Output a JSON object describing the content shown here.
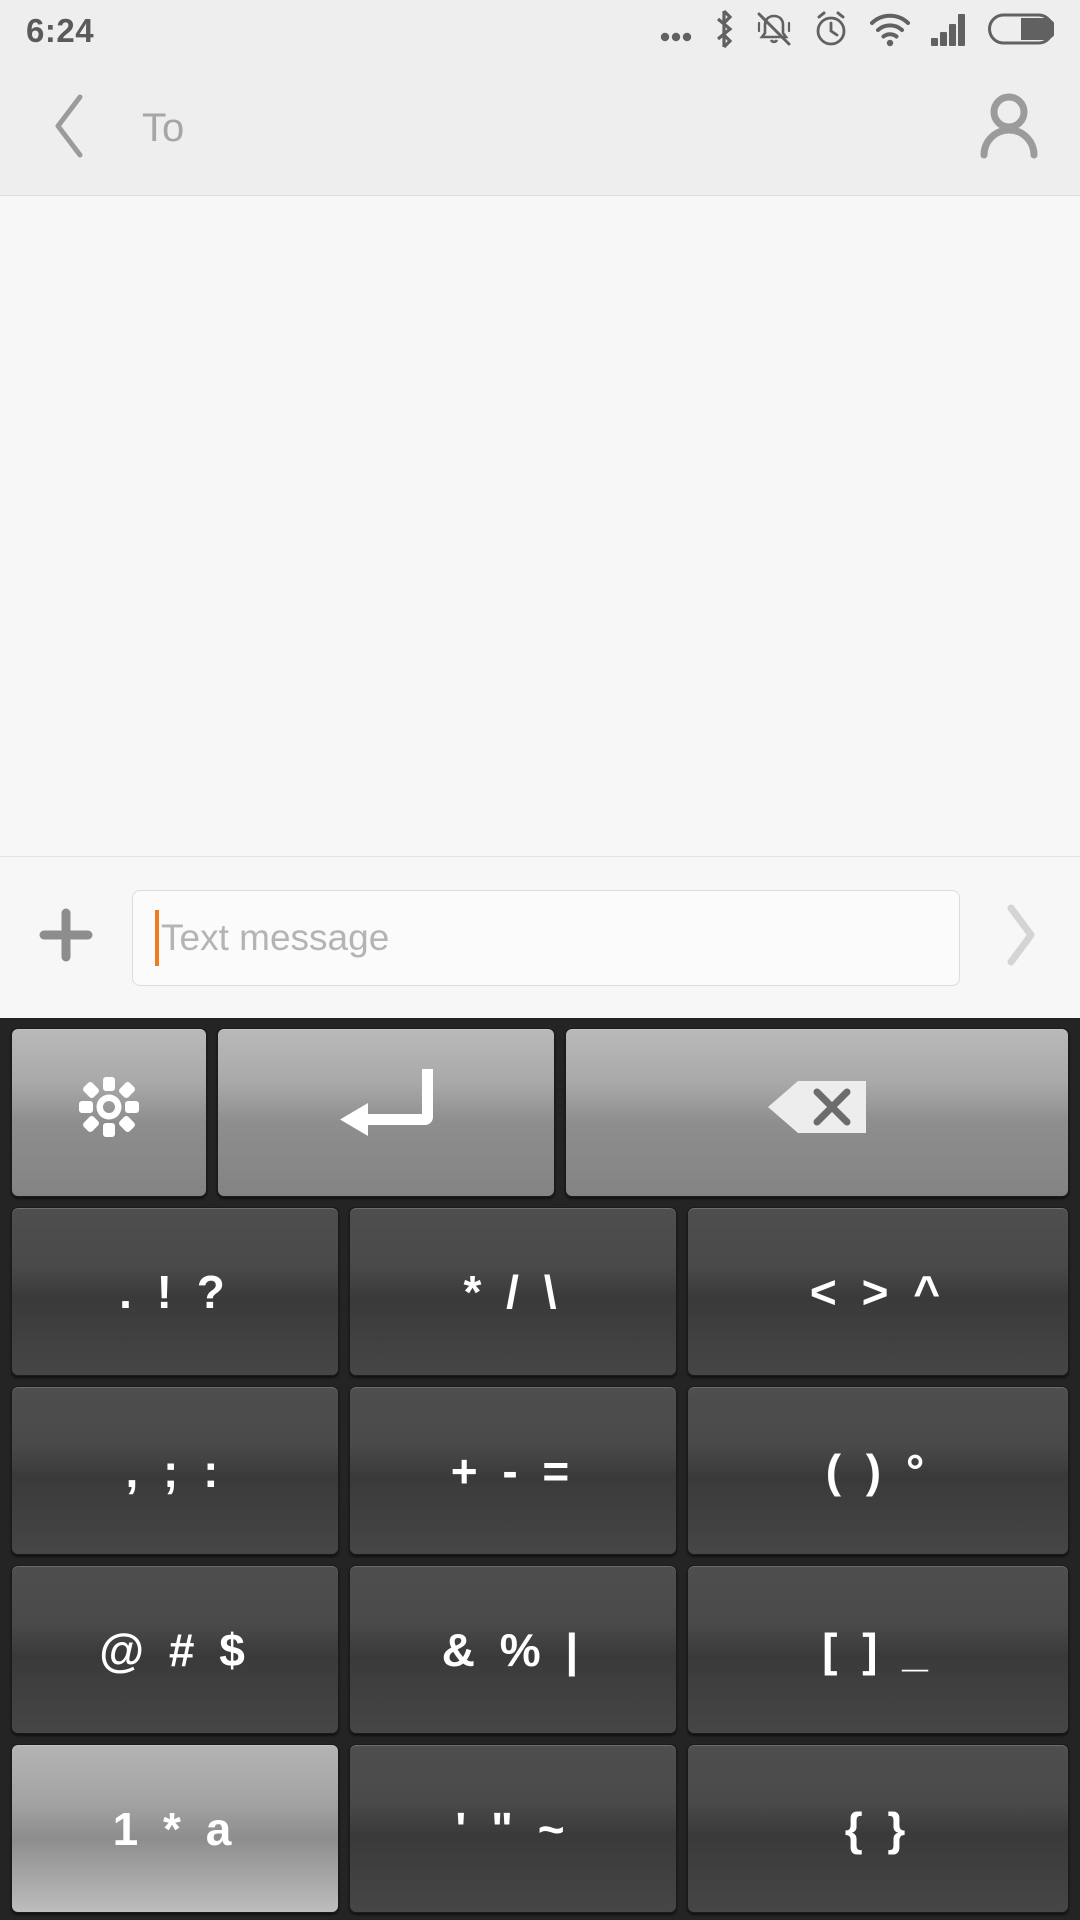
{
  "statusbar": {
    "time": "6:24",
    "icons": [
      {
        "name": "more-dots-icon"
      },
      {
        "name": "bluetooth-icon"
      },
      {
        "name": "ringer-silent-icon"
      },
      {
        "name": "alarm-clock-icon"
      },
      {
        "name": "wifi-icon"
      },
      {
        "name": "cellular-signal-icon"
      },
      {
        "name": "battery-icon"
      }
    ],
    "battery_level_pct": 55,
    "wifi_bars": 4,
    "signal_bars": 4
  },
  "appbar": {
    "back_icon": "chevron-left-icon",
    "recipient_label": "To",
    "contact_icon": "person-icon"
  },
  "conversation": {
    "messages": []
  },
  "composer": {
    "attach_icon": "plus-icon",
    "input_value": "",
    "input_placeholder": "Text message",
    "caret_color": "#f07c1e",
    "send_icon": "chevron-right-icon",
    "send_enabled": false
  },
  "keyboard": {
    "layout_name": "symbols",
    "rows": [
      {
        "type": "function",
        "keys": [
          {
            "name": "key-settings",
            "label": "",
            "icon": "gear-icon",
            "style": "light"
          },
          {
            "name": "key-enter",
            "label": "",
            "icon": "enter-icon",
            "style": "light"
          },
          {
            "name": "key-backspace",
            "label": "",
            "icon": "backspace-icon",
            "style": "light"
          }
        ]
      },
      {
        "type": "symbol",
        "keys": [
          {
            "name": "key-period-exclaim-question",
            "label": ". ! ?",
            "style": "dark"
          },
          {
            "name": "key-asterisk-slash-backslash",
            "label": "* / \\",
            "style": "dark"
          },
          {
            "name": "key-less-greater-caret",
            "label": "< > ^",
            "style": "dark"
          }
        ]
      },
      {
        "type": "symbol",
        "keys": [
          {
            "name": "key-comma-semicolon-colon",
            "label": ", ; :",
            "style": "dark"
          },
          {
            "name": "key-plus-minus-equals",
            "label": "+ - =",
            "style": "dark"
          },
          {
            "name": "key-parentheses-degree",
            "label": "( ) °",
            "style": "dark"
          }
        ]
      },
      {
        "type": "symbol",
        "keys": [
          {
            "name": "key-at-hash-dollar",
            "label": "@ # $",
            "style": "dark"
          },
          {
            "name": "key-ampersand-percent-pipe",
            "label": "& % |",
            "style": "dark"
          },
          {
            "name": "key-brackets-underscore",
            "label": "[ ] _",
            "style": "dark"
          }
        ]
      },
      {
        "type": "symbol",
        "keys": [
          {
            "name": "key-mode-switch",
            "label": "1 * a",
            "style": "bright"
          },
          {
            "name": "key-quote-doublequote-tilde",
            "label": "' \" ~",
            "style": "dark"
          },
          {
            "name": "key-braces",
            "label": "{ }",
            "style": "dark"
          }
        ]
      }
    ]
  },
  "colors": {
    "header_bg": "#eeeeee",
    "body_bg": "#f7f7f7",
    "keyboard_bg": "#242424",
    "accent_caret": "#f07c1e",
    "muted_text": "#a6a6a6"
  }
}
